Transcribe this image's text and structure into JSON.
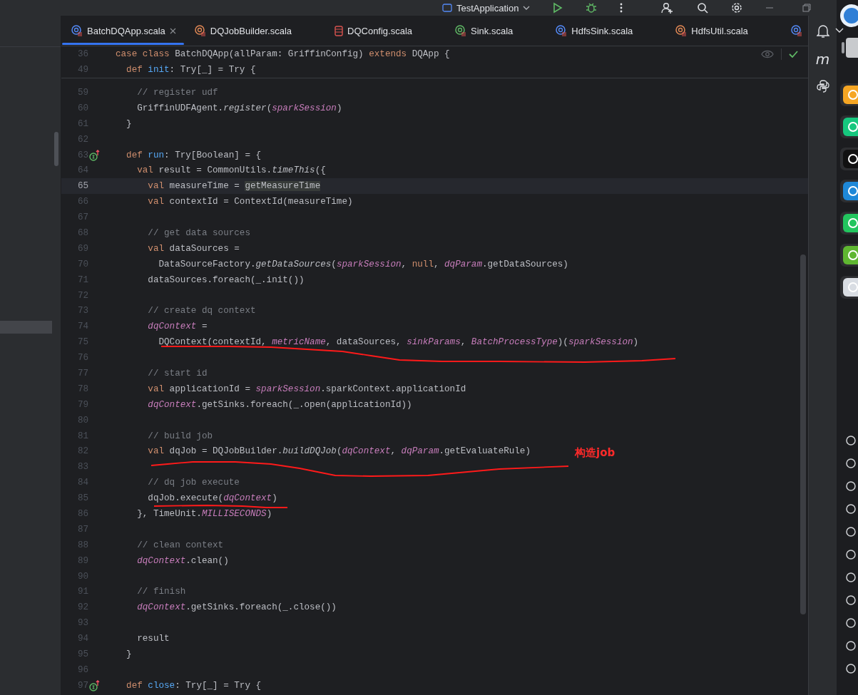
{
  "title_bar": {
    "run_config": "TestApplication"
  },
  "tabs": [
    {
      "label": "BatchDQApp.scala",
      "kind": "class",
      "selected": true
    },
    {
      "label": "DQJobBuilder.scala",
      "kind": "object",
      "selected": false
    },
    {
      "label": "DQConfig.scala",
      "kind": "config",
      "selected": false
    },
    {
      "label": "Sink.scala",
      "kind": "trait",
      "selected": false
    },
    {
      "label": "HdfsSink.scala",
      "kind": "class",
      "selected": false
    },
    {
      "label": "HdfsUtil.scala",
      "kind": "object",
      "selected": false
    },
    {
      "kind": "class",
      "selected": false
    }
  ],
  "tool_strip": {
    "label": "m"
  },
  "editor": {
    "sticky_lines": [
      {
        "number": "36",
        "tokens": [
          {
            "kind": "keyword",
            "text": "case class"
          },
          {
            "kind": "plain",
            "text": " BatchDQApp(allParam: GriffinConfig) "
          },
          {
            "kind": "keyword",
            "text": "extends"
          },
          {
            "kind": "plain",
            "text": " DQApp {"
          }
        ]
      },
      {
        "number": "49",
        "tokens": [
          {
            "kind": "keyword",
            "text": "  def"
          },
          {
            "kind": "declaration",
            "text": " init"
          },
          {
            "kind": "plain",
            "text": ": Try[_] = Try {"
          }
        ]
      }
    ],
    "lines": [
      {
        "number": "59",
        "current": false,
        "tokens": [
          {
            "kind": "comment",
            "text": "    // register udf"
          }
        ]
      },
      {
        "number": "60",
        "current": false,
        "tokens": [
          {
            "kind": "plain",
            "text": "    GriffinUDFAgent."
          },
          {
            "kind": "static_call",
            "text": "register"
          },
          {
            "kind": "plain",
            "text": "("
          },
          {
            "kind": "field",
            "text": "sparkSession"
          },
          {
            "kind": "plain",
            "text": ")"
          }
        ]
      },
      {
        "number": "61",
        "current": false,
        "tokens": [
          {
            "kind": "plain",
            "text": "  }"
          }
        ]
      },
      {
        "number": "62",
        "current": false
      },
      {
        "number": "63",
        "current": false,
        "kind": "implementing",
        "tokens": [
          {
            "kind": "keyword",
            "text": "  def"
          },
          {
            "kind": "declaration",
            "text": " run"
          },
          {
            "kind": "plain",
            "text": ": Try[Boolean] = {"
          }
        ]
      },
      {
        "number": "64",
        "current": false,
        "tokens": [
          {
            "kind": "keyword",
            "text": "    val"
          },
          {
            "kind": "plain",
            "text": " result = CommonUtils."
          },
          {
            "kind": "static_call",
            "text": "timeThis"
          },
          {
            "kind": "plain",
            "text": "({"
          }
        ]
      },
      {
        "number": "65",
        "current": true,
        "tokens": [
          {
            "kind": "keyword",
            "text": "      val"
          },
          {
            "kind": "plain",
            "text": " measureTime = "
          },
          {
            "kind": "highlighted",
            "text": "getMeasureTime"
          }
        ]
      },
      {
        "number": "66",
        "current": false,
        "tokens": [
          {
            "kind": "keyword",
            "text": "      val"
          },
          {
            "kind": "plain",
            "text": " contextId = ContextId(measureTime)"
          }
        ]
      },
      {
        "number": "67",
        "current": false
      },
      {
        "number": "68",
        "current": false,
        "tokens": [
          {
            "kind": "comment",
            "text": "      // get data sources"
          }
        ]
      },
      {
        "number": "69",
        "current": false,
        "tokens": [
          {
            "kind": "keyword",
            "text": "      val"
          },
          {
            "kind": "plain",
            "text": " dataSources ="
          }
        ]
      },
      {
        "number": "70",
        "current": false,
        "tokens": [
          {
            "kind": "plain",
            "text": "        DataSourceFactory."
          },
          {
            "kind": "static_call",
            "text": "getDataSources"
          },
          {
            "kind": "plain",
            "text": "("
          },
          {
            "kind": "field",
            "text": "sparkSession"
          },
          {
            "kind": "plain",
            "text": ", "
          },
          {
            "kind": "keyword",
            "text": "null"
          },
          {
            "kind": "plain",
            "text": ", "
          },
          {
            "kind": "field",
            "text": "dqParam"
          },
          {
            "kind": "plain",
            "text": ".getDataSources)"
          }
        ]
      },
      {
        "number": "71",
        "current": false,
        "tokens": [
          {
            "kind": "plain",
            "text": "      dataSources.foreach(_.init())"
          }
        ]
      },
      {
        "number": "72",
        "current": false
      },
      {
        "number": "73",
        "current": false,
        "tokens": [
          {
            "kind": "comment",
            "text": "      // create dq context"
          }
        ]
      },
      {
        "number": "74",
        "current": false,
        "tokens": [
          {
            "kind": "field",
            "text": "      dqContext"
          },
          {
            "kind": "plain",
            "text": " ="
          }
        ]
      },
      {
        "number": "75",
        "current": false,
        "tokens": [
          {
            "kind": "plain",
            "text": "        DQContext(contextId, "
          },
          {
            "kind": "field",
            "text": "metricName"
          },
          {
            "kind": "plain",
            "text": ", dataSources, "
          },
          {
            "kind": "field",
            "text": "sinkParams"
          },
          {
            "kind": "plain",
            "text": ", "
          },
          {
            "kind": "field",
            "text": "BatchProcessType"
          },
          {
            "kind": "plain",
            "text": ")("
          },
          {
            "kind": "field",
            "text": "sparkSession"
          },
          {
            "kind": "plain",
            "text": ")"
          }
        ]
      },
      {
        "number": "76",
        "current": false
      },
      {
        "number": "77",
        "current": false,
        "tokens": [
          {
            "kind": "comment",
            "text": "      // start id"
          }
        ]
      },
      {
        "number": "78",
        "current": false,
        "tokens": [
          {
            "kind": "keyword",
            "text": "      val"
          },
          {
            "kind": "plain",
            "text": " applicationId = "
          },
          {
            "kind": "field",
            "text": "sparkSession"
          },
          {
            "kind": "plain",
            "text": ".sparkContext.applicationId"
          }
        ]
      },
      {
        "number": "79",
        "current": false,
        "tokens": [
          {
            "kind": "field",
            "text": "      dqContext"
          },
          {
            "kind": "plain",
            "text": ".getSinks.foreach(_.open(applicationId))"
          }
        ]
      },
      {
        "number": "80",
        "current": false
      },
      {
        "number": "81",
        "current": false,
        "tokens": [
          {
            "kind": "comment",
            "text": "      // build job"
          }
        ]
      },
      {
        "number": "82",
        "current": false,
        "tokens": [
          {
            "kind": "keyword",
            "text": "      val"
          },
          {
            "kind": "plain",
            "text": " dqJob = DQJobBuilder."
          },
          {
            "kind": "static_call",
            "text": "buildDQJob"
          },
          {
            "kind": "plain",
            "text": "("
          },
          {
            "kind": "field",
            "text": "dqContext"
          },
          {
            "kind": "plain",
            "text": ", "
          },
          {
            "kind": "field",
            "text": "dqParam"
          },
          {
            "kind": "plain",
            "text": ".getEvaluateRule)"
          }
        ]
      },
      {
        "number": "83",
        "current": false
      },
      {
        "number": "84",
        "current": false,
        "tokens": [
          {
            "kind": "comment",
            "text": "      // dq job execute"
          }
        ]
      },
      {
        "number": "85",
        "current": false,
        "tokens": [
          {
            "kind": "plain",
            "text": "      dqJob.execute("
          },
          {
            "kind": "field",
            "text": "dqContext"
          },
          {
            "kind": "plain",
            "text": ")"
          }
        ]
      },
      {
        "number": "86",
        "current": false,
        "tokens": [
          {
            "kind": "plain",
            "text": "    }, TimeUnit."
          },
          {
            "kind": "field",
            "text": "MILLISECONDS"
          },
          {
            "kind": "plain",
            "text": ")"
          }
        ]
      },
      {
        "number": "87",
        "current": false
      },
      {
        "number": "88",
        "current": false,
        "tokens": [
          {
            "kind": "comment",
            "text": "    // clean context"
          }
        ]
      },
      {
        "number": "89",
        "current": false,
        "tokens": [
          {
            "kind": "field",
            "text": "    dqContext"
          },
          {
            "kind": "plain",
            "text": ".clean()"
          }
        ]
      },
      {
        "number": "90",
        "current": false
      },
      {
        "number": "91",
        "current": false,
        "tokens": [
          {
            "kind": "comment",
            "text": "    // finish"
          }
        ]
      },
      {
        "number": "92",
        "current": false,
        "tokens": [
          {
            "kind": "field",
            "text": "    dqContext"
          },
          {
            "kind": "plain",
            "text": ".getSinks.foreach(_.close())"
          }
        ]
      },
      {
        "number": "93",
        "current": false
      },
      {
        "number": "94",
        "current": false,
        "tokens": [
          {
            "kind": "plain",
            "text": "    result"
          }
        ]
      },
      {
        "number": "95",
        "current": false,
        "tokens": [
          {
            "kind": "plain",
            "text": "  }"
          }
        ]
      },
      {
        "number": "96",
        "current": false
      },
      {
        "number": "97",
        "current": false,
        "kind": "implementing",
        "tokens": [
          {
            "kind": "keyword",
            "text": "  def"
          },
          {
            "kind": "declaration",
            "text": " close"
          },
          {
            "kind": "plain",
            "text": ": Try[_] = Try {"
          }
        ]
      }
    ]
  },
  "annotation": "构造job"
}
